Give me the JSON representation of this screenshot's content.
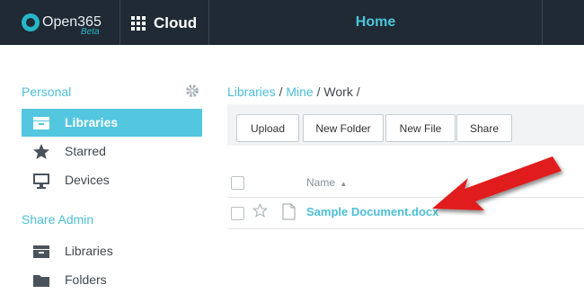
{
  "header": {
    "logo_text": "Open365",
    "logo_beta": "Beta",
    "app_label": "Cloud",
    "page_title": "Home"
  },
  "sidebar": {
    "personal_heading": "Personal",
    "personal_items": [
      {
        "label": "Libraries",
        "icon": "library-icon",
        "active": true
      },
      {
        "label": "Starred",
        "icon": "star-icon",
        "active": false
      },
      {
        "label": "Devices",
        "icon": "monitor-icon",
        "active": false
      }
    ],
    "share_admin_heading": "Share Admin",
    "share_admin_items": [
      {
        "label": "Libraries",
        "icon": "library-icon"
      },
      {
        "label": "Folders",
        "icon": "folder-icon"
      }
    ]
  },
  "breadcrumb": {
    "part1": "Libraries",
    "sep1": " / ",
    "part2": "Mine",
    "sep2": " / ",
    "part3": "Work",
    "sep3": " /"
  },
  "toolbar": {
    "upload": "Upload",
    "new_folder": "New Folder",
    "new_file": "New File",
    "share": "Share"
  },
  "file_list": {
    "name_header": "Name",
    "sort_indicator": "▲",
    "files": [
      {
        "name": "Sample Document.docx",
        "type": "document"
      }
    ]
  },
  "annotation": {
    "arrow_color": "#e11b1b"
  }
}
